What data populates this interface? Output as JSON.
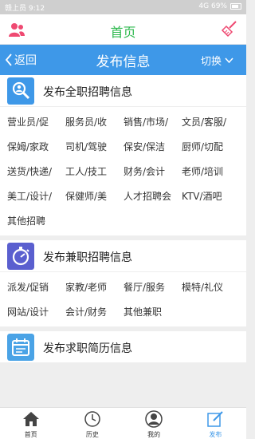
{
  "status": {
    "left": "赣上员 9:12",
    "right": "4G 69%"
  },
  "topbar": {
    "title": "首页",
    "user_icon": "user-group-icon",
    "clear_icon": "broom-icon"
  },
  "navbar": {
    "back_label": "返回",
    "title": "发布信息",
    "switch_label": "切换"
  },
  "sections": [
    {
      "title": "发布全职招聘信息",
      "icon": "search-person-icon",
      "tags": [
        "营业员/促",
        "服务员/收",
        "销售/市场/",
        "文员/客服/",
        "保姆/家政",
        "司机/驾驶",
        "保安/保洁",
        "厨师/切配",
        "送货/快递/",
        "工人/技工",
        "财务/会计",
        "老师/培训",
        "美工/设计/",
        "保健师/美",
        "人才招聘会",
        "KTV/酒吧",
        "其他招聘"
      ]
    },
    {
      "title": "发布兼职招聘信息",
      "icon": "stopwatch-icon",
      "tags": [
        "派发/促销",
        "家教/老师",
        "餐厅/服务",
        "模特/礼仪",
        "网站/设计",
        "会计/财务",
        "其他兼职"
      ]
    },
    {
      "title": "发布求职简历信息",
      "icon": "calendar-icon",
      "tags": []
    }
  ],
  "tabbar": [
    {
      "label": "首页",
      "icon": "home-icon"
    },
    {
      "label": "历史",
      "icon": "clock-icon"
    },
    {
      "label": "我的",
      "icon": "profile-icon"
    },
    {
      "label": "发布",
      "icon": "edit-icon"
    }
  ],
  "colors": {
    "accent": "#3e98e8",
    "title_green": "#2db84d",
    "icon_pink": "#ef4a72"
  }
}
